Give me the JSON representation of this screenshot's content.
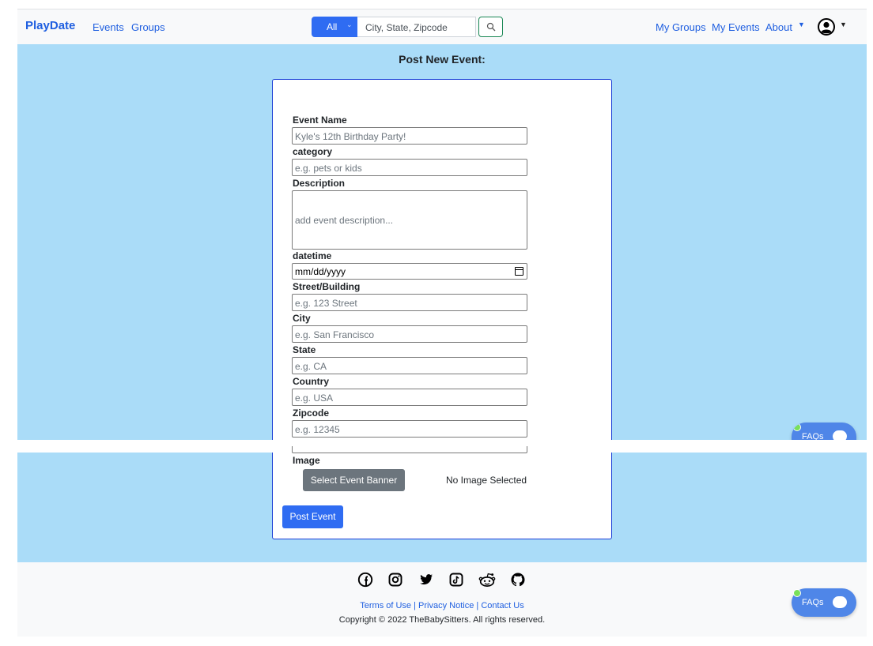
{
  "navbar": {
    "brand": "PlayDate",
    "links_left": [
      "Events",
      "Groups"
    ],
    "search": {
      "category": "All",
      "placeholder": "City, State, Zipcode"
    },
    "links_right": [
      "My Groups",
      "My Events",
      "About"
    ]
  },
  "page_title": "Post New Event:",
  "form": {
    "fields": [
      {
        "label": "Event Name",
        "placeholder": "Kyle's 12th Birthday Party!"
      },
      {
        "label": "category",
        "placeholder": "e.g. pets or kids"
      },
      {
        "label": "Description",
        "placeholder": "add event description..."
      },
      {
        "label": "datetime",
        "value": "mm/dd/yyyy"
      },
      {
        "label": "Street/Building",
        "placeholder": "e.g. 123 Street"
      },
      {
        "label": "City",
        "placeholder": "e.g. San Francisco"
      },
      {
        "label": "State",
        "placeholder": "e.g. CA"
      },
      {
        "label": "Country",
        "placeholder": "e.g. USA"
      },
      {
        "label": "Zipcode",
        "placeholder": "e.g. 12345"
      }
    ],
    "image_label": "Image",
    "select_banner_label": "Select Event Banner",
    "no_image_text": "No Image Selected",
    "submit_label": "Post Event"
  },
  "faq_label": "FAQs",
  "footer": {
    "social_icons": [
      "facebook-icon",
      "instagram-icon",
      "twitter-icon",
      "tiktok-icon",
      "reddit-icon",
      "github-icon"
    ],
    "links": [
      "Terms of Use",
      "Privacy Notice",
      "Contact Us"
    ],
    "separator": " | ",
    "copyright": "Copyright © 2022 TheBabySitters. All rights reserved."
  },
  "colors": {
    "brand": "#1f5fe0",
    "primary_button": "#2f6cf2",
    "background_band": "#aadcf8",
    "card_border": "#1a3fd6",
    "secondary_button": "#6c757d"
  }
}
